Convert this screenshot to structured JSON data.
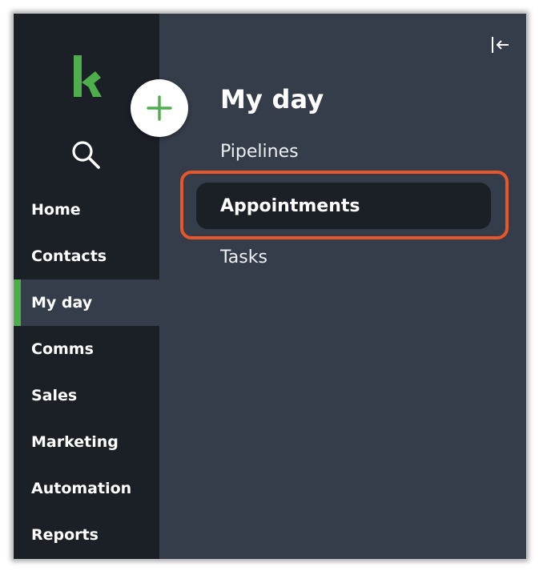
{
  "rail": {
    "logo_icon": "keap-logo-icon",
    "search_icon": "search-icon",
    "items": [
      {
        "label": "Home",
        "active": false
      },
      {
        "label": "Contacts",
        "active": false
      },
      {
        "label": "My day",
        "active": true
      },
      {
        "label": "Comms",
        "active": false
      },
      {
        "label": "Sales",
        "active": false
      },
      {
        "label": "Marketing",
        "active": false
      },
      {
        "label": "Automation",
        "active": false
      },
      {
        "label": "Reports",
        "active": false
      }
    ]
  },
  "add_button": {
    "icon": "plus-icon"
  },
  "panel": {
    "collapse_icon": "collapse-left-icon",
    "title": "My day",
    "items": [
      {
        "label": "Pipelines",
        "active": false
      },
      {
        "label": "Appointments",
        "active": true
      },
      {
        "label": "Tasks",
        "active": false
      }
    ]
  },
  "colors": {
    "rail_bg": "#1b1f26",
    "panel_bg": "#353d4a",
    "brand_green": "#4fae4c",
    "highlight_orange": "#e8562c"
  }
}
